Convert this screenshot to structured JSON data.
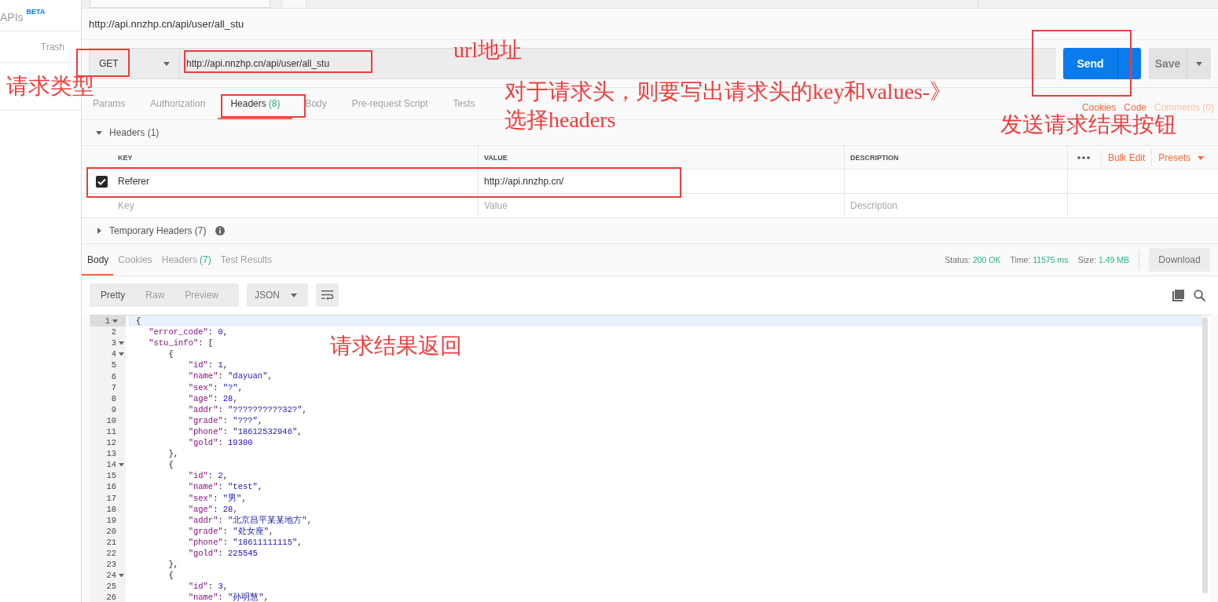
{
  "sidebar": {
    "apis_label": "APIs",
    "apis_badge": "BETA",
    "trash": "Trash"
  },
  "request": {
    "title": "http://api.nnzhp.cn/api/user/all_stu",
    "method": "GET",
    "url": "http://api.nnzhp.cn/api/user/all_stu",
    "send": "Send",
    "save": "Save"
  },
  "request_tabs": [
    {
      "label": "Params",
      "selected": false
    },
    {
      "label": "Authorization",
      "selected": false
    },
    {
      "label": "Headers",
      "count": "(8)",
      "selected": true
    },
    {
      "label": "Body",
      "selected": false
    },
    {
      "label": "Pre-request Script",
      "selected": false
    },
    {
      "label": "Tests",
      "selected": false
    }
  ],
  "request_links": [
    {
      "label": "Cookies",
      "disabled": false
    },
    {
      "label": "Code",
      "disabled": false
    },
    {
      "label": "Comments (0)",
      "disabled": true
    }
  ],
  "headers_section": {
    "title": "Headers (1)",
    "expanded": true
  },
  "headers_table": {
    "columns": [
      "KEY",
      "VALUE",
      "DESCRIPTION"
    ],
    "actions": [
      "Bulk Edit",
      "Presets"
    ],
    "rows": [
      {
        "checked": true,
        "key": "Referer",
        "value": "http://api.nnzhp.cn/"
      }
    ],
    "placeholder_row": [
      {
        "placeholder": "Key"
      },
      {
        "placeholder": "Value"
      },
      {
        "placeholder": "Description"
      }
    ]
  },
  "temporary_headers": {
    "title": "Temporary Headers",
    "count": "(7)",
    "expanded": false
  },
  "response_tabs": [
    {
      "label": "Body",
      "selected": true
    },
    {
      "label": "Cookies",
      "selected": false
    },
    {
      "label": "Headers",
      "count": "(7)",
      "selected": false
    },
    {
      "label": "Test Results",
      "selected": false
    }
  ],
  "response_status": [
    {
      "label": "Status:",
      "value": "200 OK"
    },
    {
      "label": "Time:",
      "value": "11575 ms"
    },
    {
      "label": "Size:",
      "value": "1.49 MB"
    }
  ],
  "download": "Download",
  "view_modes": [
    {
      "label": "Pretty",
      "selected": true
    },
    {
      "label": "Raw",
      "selected": false
    },
    {
      "label": "Preview",
      "selected": false
    }
  ],
  "format": "JSON",
  "code_lines": [
    {
      "number": "1",
      "text": "{",
      "foldable": true,
      "active": true
    },
    {
      "number": "2",
      "text": "    \"error_code\": 0,",
      "foldable": false,
      "active": false
    },
    {
      "number": "3",
      "text": "    \"stu_info\": [",
      "foldable": true,
      "active": false
    },
    {
      "number": "4",
      "text": "        {",
      "foldable": true,
      "active": false
    },
    {
      "number": "5",
      "text": "            \"id\": 1,",
      "foldable": false,
      "active": false
    },
    {
      "number": "6",
      "text": "            \"name\": \"dayuan\",",
      "foldable": false,
      "active": false
    },
    {
      "number": "7",
      "text": "            \"sex\": \"?\",",
      "foldable": false,
      "active": false
    },
    {
      "number": "8",
      "text": "            \"age\": 28,",
      "foldable": false,
      "active": false
    },
    {
      "number": "9",
      "text": "            \"addr\": \"??????????32?\",",
      "foldable": false,
      "active": false
    },
    {
      "number": "10",
      "text": "            \"grade\": \"???\",",
      "foldable": false,
      "active": false
    },
    {
      "number": "11",
      "text": "            \"phone\": \"18612532946\",",
      "foldable": false,
      "active": false
    },
    {
      "number": "12",
      "text": "            \"gold\": 19300",
      "foldable": false,
      "active": false
    },
    {
      "number": "13",
      "text": "        },",
      "foldable": false,
      "active": false
    },
    {
      "number": "14",
      "text": "        {",
      "foldable": true,
      "active": false
    },
    {
      "number": "15",
      "text": "            \"id\": 2,",
      "foldable": false,
      "active": false
    },
    {
      "number": "16",
      "text": "            \"name\": \"test\",",
      "foldable": false,
      "active": false
    },
    {
      "number": "17",
      "text": "            \"sex\": \"男\",",
      "foldable": false,
      "active": false
    },
    {
      "number": "18",
      "text": "            \"age\": 28,",
      "foldable": false,
      "active": false
    },
    {
      "number": "19",
      "text": "            \"addr\": \"北京昌平某某地方\",",
      "foldable": false,
      "active": false
    },
    {
      "number": "20",
      "text": "            \"grade\": \"处女座\",",
      "foldable": false,
      "active": false
    },
    {
      "number": "21",
      "text": "            \"phone\": \"18611111115\",",
      "foldable": false,
      "active": false
    },
    {
      "number": "22",
      "text": "            \"gold\": 225545",
      "foldable": false,
      "active": false
    },
    {
      "number": "23",
      "text": "        },",
      "foldable": false,
      "active": false
    },
    {
      "number": "24",
      "text": "        {",
      "foldable": true,
      "active": false
    },
    {
      "number": "25",
      "text": "            \"id\": 3,",
      "foldable": false,
      "active": false
    },
    {
      "number": "26",
      "text": "            \"name\": \"孙明慧\",",
      "foldable": false,
      "active": false
    }
  ],
  "annotations": [
    {
      "kind": "box"
    },
    {
      "kind": "box"
    },
    {
      "kind": "box"
    },
    {
      "kind": "box"
    },
    {
      "kind": "box"
    },
    {
      "kind": "note",
      "text": "请求类型"
    },
    {
      "kind": "note",
      "text": "url地址"
    },
    {
      "kind": "note",
      "text": "对于请求头，则要写出请求头的key和values-》选择headers"
    },
    {
      "kind": "note",
      "text": "发送请求结果按钮"
    },
    {
      "kind": "note",
      "text": "请求结果返回"
    }
  ]
}
